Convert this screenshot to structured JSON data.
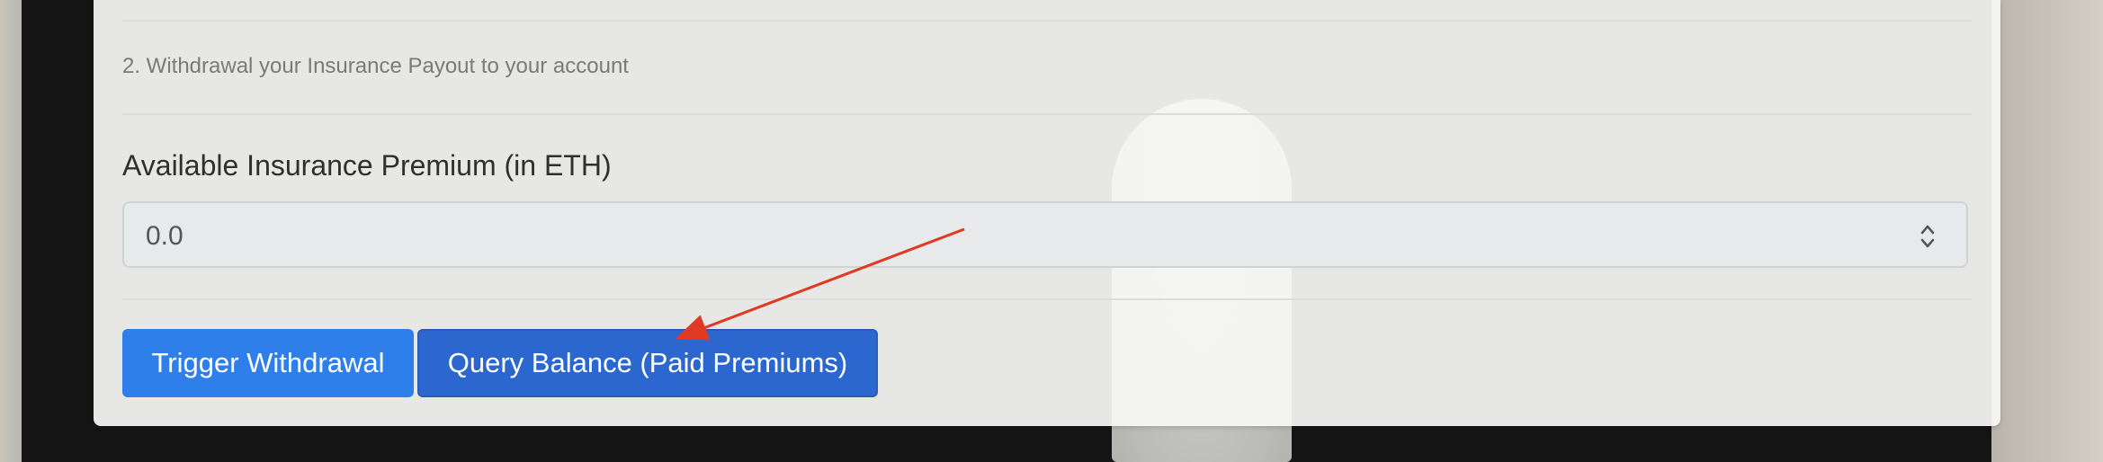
{
  "section": {
    "step_text": "2. Withdrawal your Insurance Payout to your account"
  },
  "premium": {
    "label": "Available Insurance Premium (in ETH)",
    "value": "0.0"
  },
  "actions": {
    "trigger_withdrawal": "Trigger Withdrawal",
    "query_balance": "Query Balance (Paid Premiums)"
  },
  "colors": {
    "primary_button": "#2f7fea",
    "secondary_button": "#2b67cf",
    "annotation_arrow": "#e03a22"
  },
  "icons": {
    "select_arrows": "chevron-up-down-icon",
    "annotation": "arrow-annotation"
  }
}
